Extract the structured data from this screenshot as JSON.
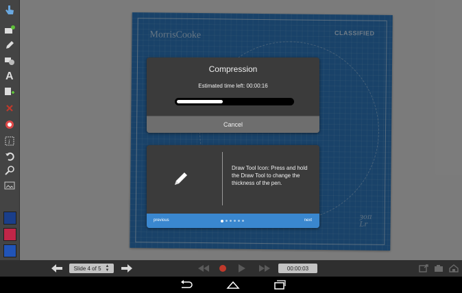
{
  "toolbar": {
    "tools": [
      "hand-pointer-icon",
      "add-slide-icon",
      "pencil-icon",
      "shapes-icon",
      "text-icon",
      "add-media-icon",
      "delete-icon",
      "record-icon",
      "info-icon",
      "undo-icon",
      "zoom-icon",
      "image-icon"
    ],
    "swatches": [
      "#1a3e8a",
      "#c02648",
      "#2154b8"
    ]
  },
  "slide": {
    "brand": "MorrisCooke",
    "classified": "CLASSIFIED",
    "color": "#2b73b5"
  },
  "compression_dialog": {
    "title": "Compression",
    "time_label": "Estimated time left: 00:00:16",
    "progress": 0.4,
    "cancel_label": "Cancel"
  },
  "tip": {
    "icon": "pencil-icon",
    "text": "Draw Tool Icon: Press and hold the Draw Tool to change the thickness of the pen.",
    "previous_label": "previous",
    "next_label": "next",
    "page_count": 6,
    "current_page": 1
  },
  "player_bar": {
    "slide_label": "Slide 4 of 5",
    "time": "00:00:03",
    "accent_record": "#c0392b"
  },
  "nav_bar": {
    "buttons": [
      "back-icon",
      "home-icon",
      "recents-icon"
    ]
  }
}
